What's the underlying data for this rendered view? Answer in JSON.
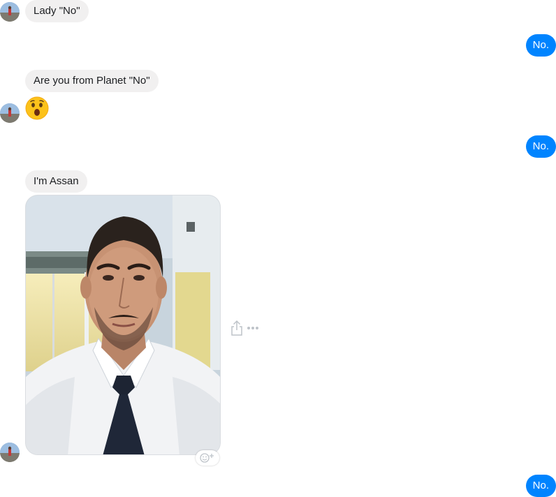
{
  "messages": {
    "m1": {
      "text": "Lady \"No\""
    },
    "m2": {
      "text": "No."
    },
    "m3": {
      "text": "Are you from Planet \"No\""
    },
    "m4": {
      "emoji": "astonished-face"
    },
    "m5": {
      "text": "No."
    },
    "m6": {
      "text": "I'm Assan"
    },
    "m7": {
      "image": "selfie-photo-man-white-shirt-dark-tie"
    },
    "m8": {
      "text": "No."
    }
  },
  "icons": {
    "share": "share-icon",
    "more": "more-options-icon",
    "react": "add-reaction-icon"
  },
  "colors": {
    "outgoing_bubble": "#0084ff",
    "incoming_bubble": "#f1f0f0",
    "incoming_text": "#1c1e21",
    "outgoing_text": "#ffffff"
  }
}
